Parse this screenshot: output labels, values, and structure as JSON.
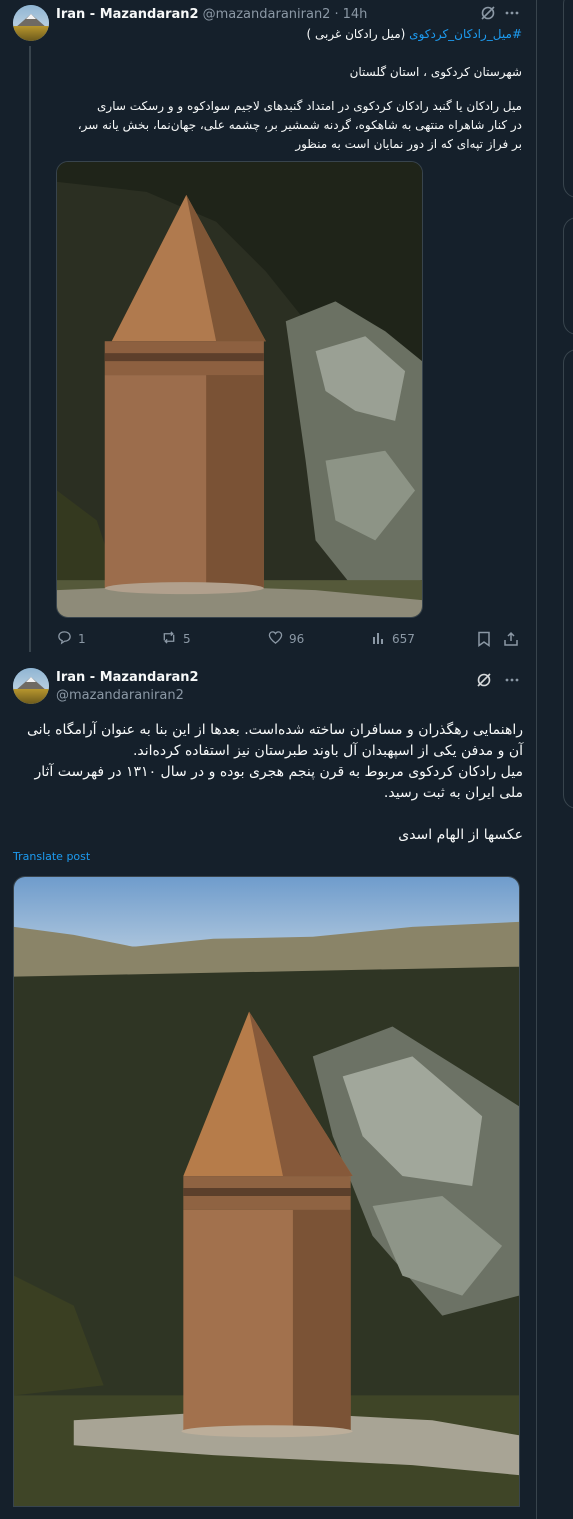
{
  "tweet1": {
    "author_name": "Iran - Mazandaran2",
    "author_handle": "@mazandaraniran2",
    "separator": "·",
    "time": "14h",
    "line1_hashtag": "#میل_رادکان_کردکوی",
    "line1_rest": " (میل رادکان غربی )",
    "line2": "شهرستان کردکوی ، استان گلستان",
    "line3": "میل رادکان  یا گنبد رادکان کردکوی در امتداد گنبدهای لاجیم سوادکوه و  و رسکت ساری",
    "line4": "در کنار شاهراه منتهی به شاهکوه، گردنه شمشیر بر، چشمه علی، جهان‌نما، بخش یانه سر،",
    "line5": "بر فراز تپه‌ای که از دور نمایان است به منظور",
    "replies": "1",
    "reposts": "5",
    "likes": "96",
    "views": "657"
  },
  "tweet2": {
    "author_name": "Iran - Mazandaran2",
    "author_handle": "@mazandaraniran2",
    "para1_l1": "راهنمایی رهگذران و مسافران ساخته شده‌است. بعدها از این بنا به عنوان آرامگاه بانی",
    "para1_l2": "آن و مدفن یکی از اسپهبدان آل باوند طبرستان نیز استفاده کرده‌اند.",
    "para1_l3": "میل رادکان کردکوی مربوط به قرن پنجم هجری بوده و در سال ۱۳۱۰ در فهرست آثار",
    "para1_l4": "ملی ایران به ثبت رسید.",
    "para2": "عکسها از الهام اسدی",
    "translate_label": "Translate post"
  },
  "icons": {
    "more": "more-icon",
    "grok": "grok-icon",
    "reply": "reply-icon",
    "repost": "repost-icon",
    "like": "like-icon",
    "views": "views-icon",
    "bookmark": "bookmark-icon",
    "share": "share-icon"
  },
  "colors": {
    "background": "#15202b",
    "accent": "#1d9bf0",
    "secondary_text": "#8b98a5",
    "border": "#38444d"
  }
}
